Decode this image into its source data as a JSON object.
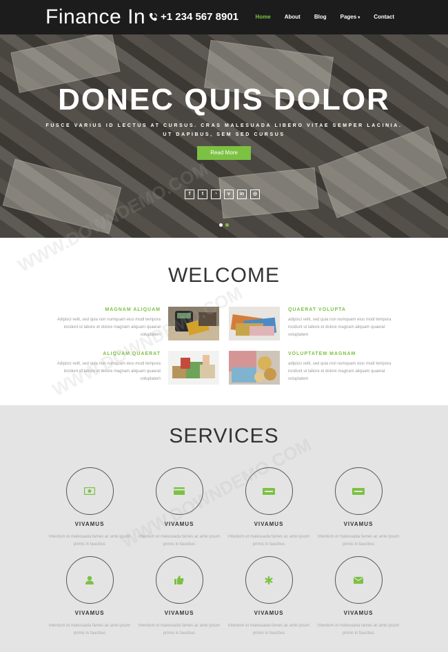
{
  "header": {
    "logo": "Finance In",
    "phone": "+1 234 567 8901",
    "nav": [
      {
        "label": "Home",
        "active": true
      },
      {
        "label": "About",
        "active": false
      },
      {
        "label": "Blog",
        "active": false
      },
      {
        "label": "Pages",
        "active": false,
        "dropdown": true
      },
      {
        "label": "Contact",
        "active": false
      }
    ]
  },
  "hero": {
    "title": "DONEC QUIS DOLOR",
    "subtitle": "FUSCE VARIUS ID LECTUS AT CURSUS. CRAS MALESUADA LIBERO VITAE SEMPER LACINIA. UT DAPIBUS, SEM SED CURSUS",
    "button": "Read More",
    "socials": [
      "facebook-icon",
      "twitter-icon",
      "rss-icon",
      "vimeo-icon",
      "linkedin-icon",
      "dribbble-icon"
    ],
    "slides": 2,
    "active_slide": 1
  },
  "welcome": {
    "title": "WELCOME",
    "features": [
      {
        "title": "MAGNAM ALIQUAM",
        "text": "Adipisci velit, sed quia non numquam eius modi tempora incidunt ut labore et dolore magnam aliquam quaerat voluptatem"
      },
      {
        "title": "QUAERAT VOLUPTA",
        "text": "adipisci velit, sed quia non numquam eius modi tempora incidunt ut labore et dolore magnam aliquam quaerat voluptatem"
      },
      {
        "title": "ALIQUAM QUAERAT",
        "text": "Adipisci velit, sed quia non numquam eius modi tempora incidunt ut labore et dolore magnam aliquam quaerat voluptatem"
      },
      {
        "title": "VOLUPTATEM MAGNAM",
        "text": "adipisci velit, sed quia non numquam eius modi tempora incidunt ut labore et dolore magnam aliquam quaerat voluptatem"
      }
    ]
  },
  "services": {
    "title": "SERVICES",
    "items": [
      {
        "title": "VIVAMUS",
        "text": "Interdum et malesuada fames ac ante ipsum primis in faucibus",
        "icon": "money-icon"
      },
      {
        "title": "VIVAMUS",
        "text": "Interdum et malesuada fames ac ante ipsum primis in faucibus",
        "icon": "credit-card-icon"
      },
      {
        "title": "VIVAMUS",
        "text": "Interdum et malesuada fames ac ante ipsum primis in faucibus",
        "icon": "paypal-icon"
      },
      {
        "title": "VIVAMUS",
        "text": "Interdum et malesuada fames ac ante ipsum primis in faucibus",
        "icon": "stripe-icon"
      },
      {
        "title": "VIVAMUS",
        "text": "Interdum et malesuada fames ac ante ipsum primis in faucibus",
        "icon": "user-icon"
      },
      {
        "title": "VIVAMUS",
        "text": "Interdum et malesuada fames ac ante ipsum primis in faucibus",
        "icon": "thumbs-up-icon"
      },
      {
        "title": "VIVAMUS",
        "text": "Interdum et malesuada fames ac ante ipsum primis in faucibus",
        "icon": "asterisk-icon"
      },
      {
        "title": "VIVAMUS",
        "text": "Interdum et malesuada fames ac ante ipsum primis in faucibus",
        "icon": "envelope-icon"
      }
    ]
  },
  "watermark": "WWW.DOWNDEMO.COM",
  "colors": {
    "accent": "#7cc142",
    "header_bg": "#1c1c1c",
    "services_bg": "#e4e4e4"
  }
}
